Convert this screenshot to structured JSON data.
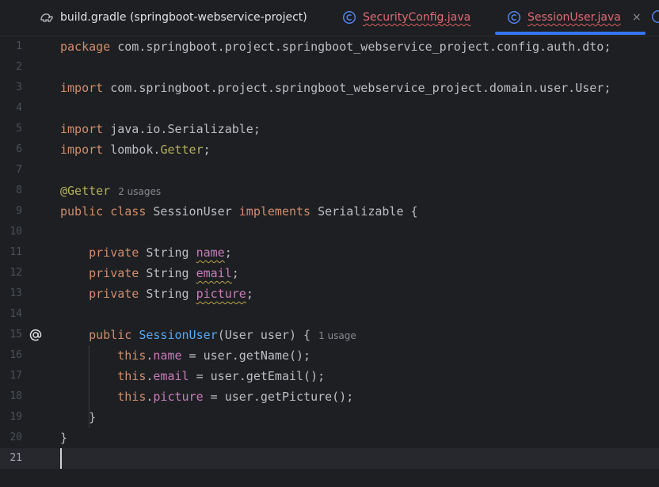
{
  "tabs": [
    {
      "label": "build.gradle (springboot-webservice-project)",
      "icon": "gradle-icon"
    },
    {
      "label": "SecurityConfig.java",
      "icon": "class-icon"
    },
    {
      "label": "SessionUser.java",
      "icon": "class-icon",
      "active": true,
      "close": "×"
    }
  ],
  "editor": {
    "line_numbers": [
      "1",
      "2",
      "3",
      "4",
      "5",
      "6",
      "7",
      "8",
      "9",
      "10",
      "11",
      "12",
      "13",
      "14",
      "15",
      "16",
      "17",
      "18",
      "19",
      "20",
      "21"
    ],
    "current_line": "21",
    "line1": {
      "kw": "package",
      "text": " com.springboot.project.springboot_webservice_project.config.auth.dto;"
    },
    "line3": {
      "kw": "import",
      "text": " com.springboot.project.springboot_webservice_project.domain.user.User;"
    },
    "line5": {
      "kw": "import",
      "text": " java.io.Serializable;"
    },
    "line6": {
      "kw": "import",
      "pkg": " lombok.",
      "ann": "Getter",
      "end": ";"
    },
    "line8": {
      "ann": "@Getter",
      "hint": "2 usages"
    },
    "line9": {
      "kw1": "public",
      "kw2": "class",
      "name": "SessionUser",
      "kw3": "implements",
      "rest": " Serializable {"
    },
    "line11": {
      "kw": "private",
      "type": " String ",
      "field": "name",
      "end": ";"
    },
    "line12": {
      "kw": "private",
      "type": " String ",
      "field": "email",
      "end": ";"
    },
    "line13": {
      "kw": "private",
      "type": " String ",
      "field": "picture",
      "end": ";"
    },
    "line15": {
      "kw": "public",
      "ctor": "SessionUser",
      "params": "(User user) {",
      "hint": "1 usage",
      "gutter": "@"
    },
    "line16": {
      "kw": "this",
      "dot": ".",
      "field": "name",
      "rest": " = user.getName();"
    },
    "line17": {
      "kw": "this",
      "dot": ".",
      "field": "email",
      "rest": " = user.getEmail();"
    },
    "line18": {
      "kw": "this",
      "dot": ".",
      "field": "picture",
      "rest": " = user.getPicture();"
    },
    "line19": {
      "text": "}"
    },
    "line20": {
      "text": "}"
    }
  },
  "colors": {
    "background": "#1e1f22",
    "keyword": "#cf8e6d",
    "annotation": "#b3ae60",
    "field": "#c77dbb",
    "method": "#56a8f5",
    "tab_indicator": "#3574f0"
  }
}
